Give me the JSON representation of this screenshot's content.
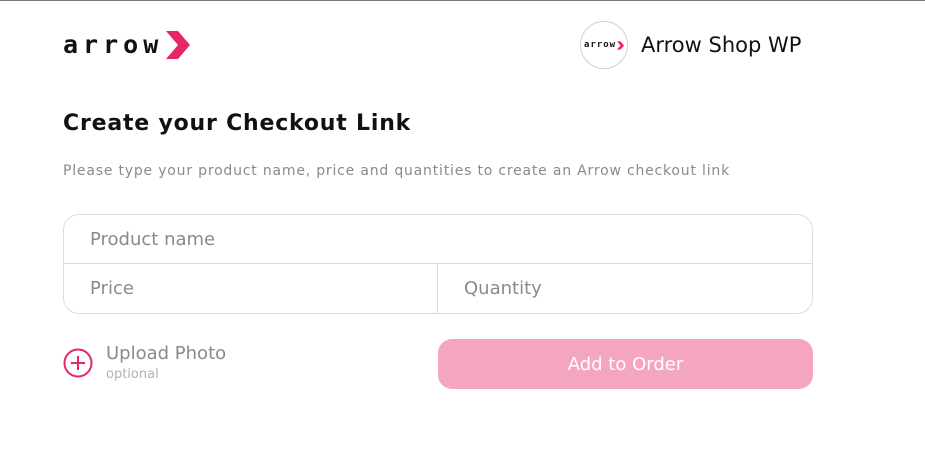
{
  "brand": {
    "logo_text": "arrow",
    "accent_color": "#e8256a"
  },
  "shop": {
    "avatar_text": "arrow",
    "name": "Arrow Shop WP"
  },
  "page": {
    "title": "Create your Checkout Link",
    "subtitle": "Please type your product name, price and quantities to create an Arrow checkout link"
  },
  "form": {
    "product_placeholder": "Product name",
    "price_placeholder": "Price",
    "quantity_placeholder": "Quantity"
  },
  "upload": {
    "label": "Upload Photo",
    "hint": "optional",
    "icon": "plus-circle-icon"
  },
  "actions": {
    "add_to_order_label": "Add to Order",
    "button_color": "#f4a6c1"
  }
}
